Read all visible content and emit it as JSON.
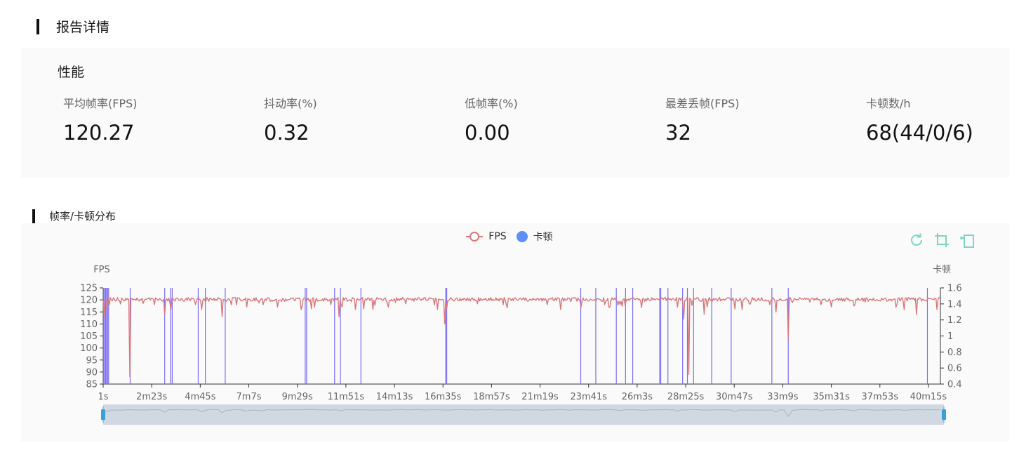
{
  "report": {
    "title": "报告详情"
  },
  "performance": {
    "title": "性能",
    "metrics": [
      {
        "label": "平均帧率(FPS)",
        "value": "120.27"
      },
      {
        "label": "抖动率(%)",
        "value": "0.32"
      },
      {
        "label": "低帧率(%)",
        "value": "0.00"
      },
      {
        "label": "最差丢帧(FPS)",
        "value": "32"
      },
      {
        "label": "卡顿数/h",
        "value": "68(44/0/6)"
      }
    ]
  },
  "chart_section": {
    "title": "帧率/卡顿分布"
  },
  "toolbox": {
    "icons": [
      "restore-icon",
      "zoom-icon",
      "zoom-reset-icon"
    ]
  },
  "colors": {
    "fps": "#d9777a",
    "jank": "#7b6cf6",
    "jank_legend": "#5b8ff9",
    "toolbox": "#7ed6c2",
    "slider_handle": "#3aa0d8"
  },
  "chart_data": {
    "type": "line",
    "title": "",
    "legend": [
      "FPS",
      "卡顿"
    ],
    "legend_position": "top-center",
    "grid": false,
    "y_left": {
      "name": "FPS",
      "min": 85,
      "max": 125,
      "ticks": [
        125,
        120,
        115,
        110,
        105,
        100,
        95,
        90,
        85
      ]
    },
    "y_right": {
      "name": "卡顿",
      "min": 0.4,
      "max": 1.6,
      "ticks": [
        "1.6",
        "1.4",
        "1.2",
        "1",
        "0.8",
        "0.6",
        "0.4"
      ]
    },
    "x": {
      "unit": "s",
      "min": 1,
      "max": 2450,
      "ticks": [
        {
          "t": 1,
          "label": "1s"
        },
        {
          "t": 143,
          "label": "2m23s"
        },
        {
          "t": 285,
          "label": "4m45s"
        },
        {
          "t": 427,
          "label": "7m7s"
        },
        {
          "t": 569,
          "label": "9m29s"
        },
        {
          "t": 711,
          "label": "11m51s"
        },
        {
          "t": 853,
          "label": "14m13s"
        },
        {
          "t": 995,
          "label": "16m35s"
        },
        {
          "t": 1137,
          "label": "18m57s"
        },
        {
          "t": 1279,
          "label": "21m19s"
        },
        {
          "t": 1421,
          "label": "23m41s"
        },
        {
          "t": 1563,
          "label": "26m3s"
        },
        {
          "t": 1705,
          "label": "28m25s"
        },
        {
          "t": 1847,
          "label": "30m47s"
        },
        {
          "t": 1989,
          "label": "33m9s"
        },
        {
          "t": 2131,
          "label": "35m31s"
        },
        {
          "t": 2273,
          "label": "37m53s"
        },
        {
          "t": 2415,
          "label": "40m15s"
        }
      ]
    },
    "fps_baseline": 121,
    "fps_dips": [
      [
        5,
        113
      ],
      [
        12,
        116
      ],
      [
        20,
        118
      ],
      [
        80,
        88
      ],
      [
        180,
        114
      ],
      [
        200,
        116
      ],
      [
        290,
        116
      ],
      [
        350,
        113
      ],
      [
        375,
        118
      ],
      [
        420,
        117
      ],
      [
        470,
        118
      ],
      [
        510,
        117
      ],
      [
        580,
        116
      ],
      [
        620,
        117
      ],
      [
        668,
        118
      ],
      [
        690,
        113
      ],
      [
        700,
        117
      ],
      [
        740,
        116
      ],
      [
        790,
        116
      ],
      [
        835,
        117
      ],
      [
        980,
        116
      ],
      [
        1000,
        110
      ],
      [
        1170,
        118
      ],
      [
        1300,
        118
      ],
      [
        1340,
        116
      ],
      [
        1400,
        117
      ],
      [
        1480,
        117
      ],
      [
        1680,
        117
      ],
      [
        1700,
        112
      ],
      [
        1715,
        89
      ],
      [
        1760,
        114
      ],
      [
        1870,
        116
      ],
      [
        1950,
        118
      ],
      [
        1970,
        115
      ],
      [
        2005,
        104
      ],
      [
        2100,
        118
      ],
      [
        2200,
        118
      ],
      [
        2320,
        117
      ],
      [
        2380,
        114
      ],
      [
        2440,
        116
      ]
    ],
    "jank_events_s": [
      2,
      5,
      8,
      11,
      14,
      17,
      80,
      181,
      198,
      203,
      279,
      300,
      358,
      592,
      596,
      678,
      695,
      755,
      1003,
      1006,
      1398,
      1442,
      1502,
      1529,
      1550,
      1629,
      1632,
      1653,
      1696,
      1710,
      1728,
      1781,
      1838,
      1957,
      2005,
      2412,
      2463
    ]
  },
  "datazoom": {
    "start_pct": 0,
    "end_pct": 100
  }
}
